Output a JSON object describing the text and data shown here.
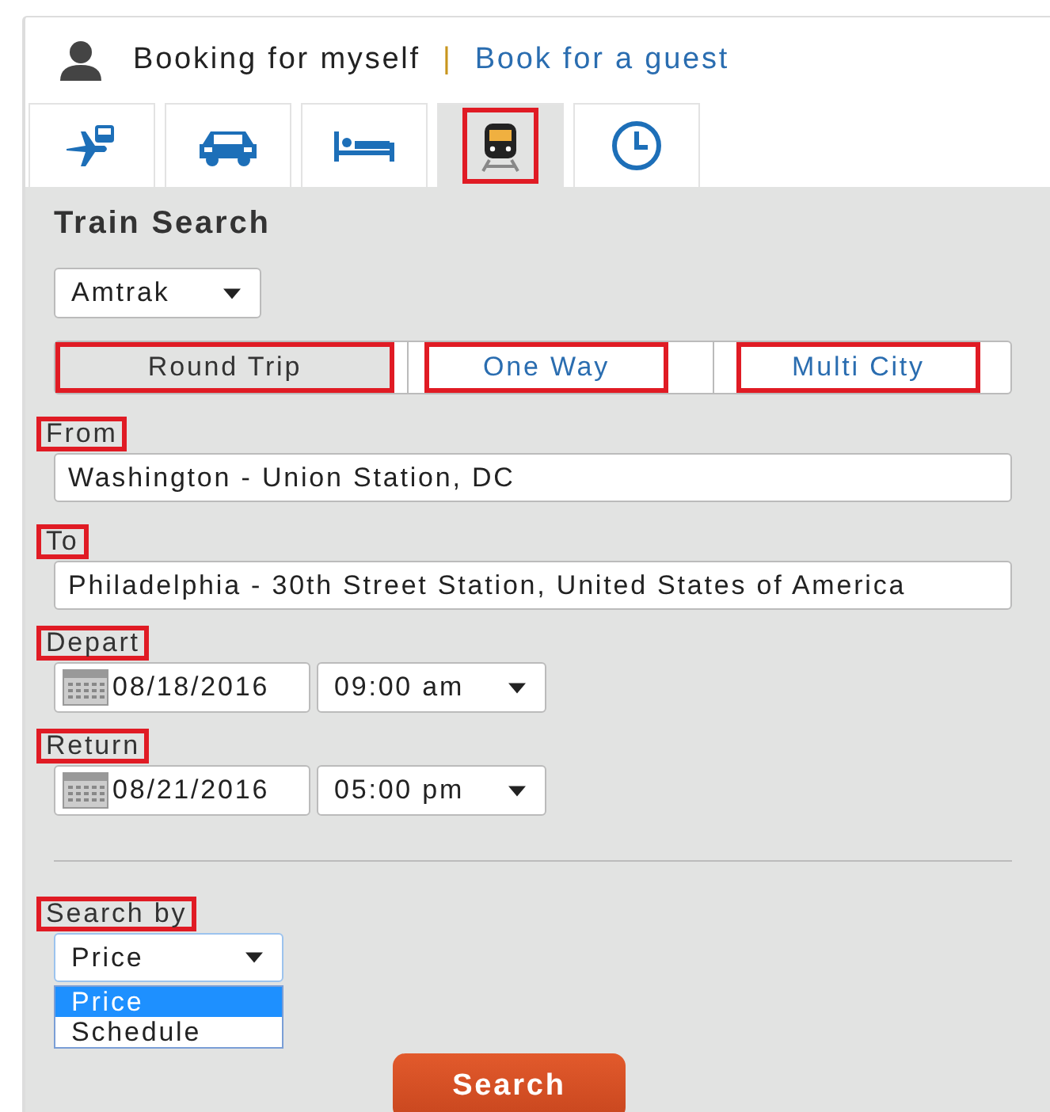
{
  "header": {
    "user_label": "Booking for myself",
    "separator": "|",
    "guest_link": "Book for a guest"
  },
  "tabs": [
    {
      "kind": "flight-train",
      "selected": false,
      "highlighted": false
    },
    {
      "kind": "car",
      "selected": false,
      "highlighted": false
    },
    {
      "kind": "hotel",
      "selected": false,
      "highlighted": false
    },
    {
      "kind": "train",
      "selected": true,
      "highlighted": true
    },
    {
      "kind": "clock",
      "selected": false,
      "highlighted": false
    }
  ],
  "form": {
    "title": "Train Search",
    "carrier": "Amtrak",
    "trip_types": [
      {
        "label": "Round Trip",
        "selected": true,
        "highlighted": true
      },
      {
        "label": "One Way",
        "selected": false,
        "highlighted": true
      },
      {
        "label": "Multi City",
        "selected": false,
        "highlighted": true
      }
    ],
    "locations": [
      {
        "label": "From",
        "highlighted": true,
        "value": "Washington - Union Station, DC"
      },
      {
        "label": "To",
        "highlighted": true,
        "value": "Philadelphia - 30th Street Station, United States of America"
      }
    ],
    "dates": [
      {
        "label": "Depart",
        "highlighted": true,
        "date": "08/18/2016",
        "time": "09:00 am"
      },
      {
        "label": "Return",
        "highlighted": true,
        "date": "08/21/2016",
        "time": "05:00 pm"
      }
    ],
    "search_by": {
      "label": "Search by",
      "highlighted": true,
      "value": "Price",
      "options": [
        {
          "label": "Price",
          "selected": true
        },
        {
          "label": "Schedule",
          "selected": false
        }
      ]
    },
    "search_button": "Search"
  }
}
